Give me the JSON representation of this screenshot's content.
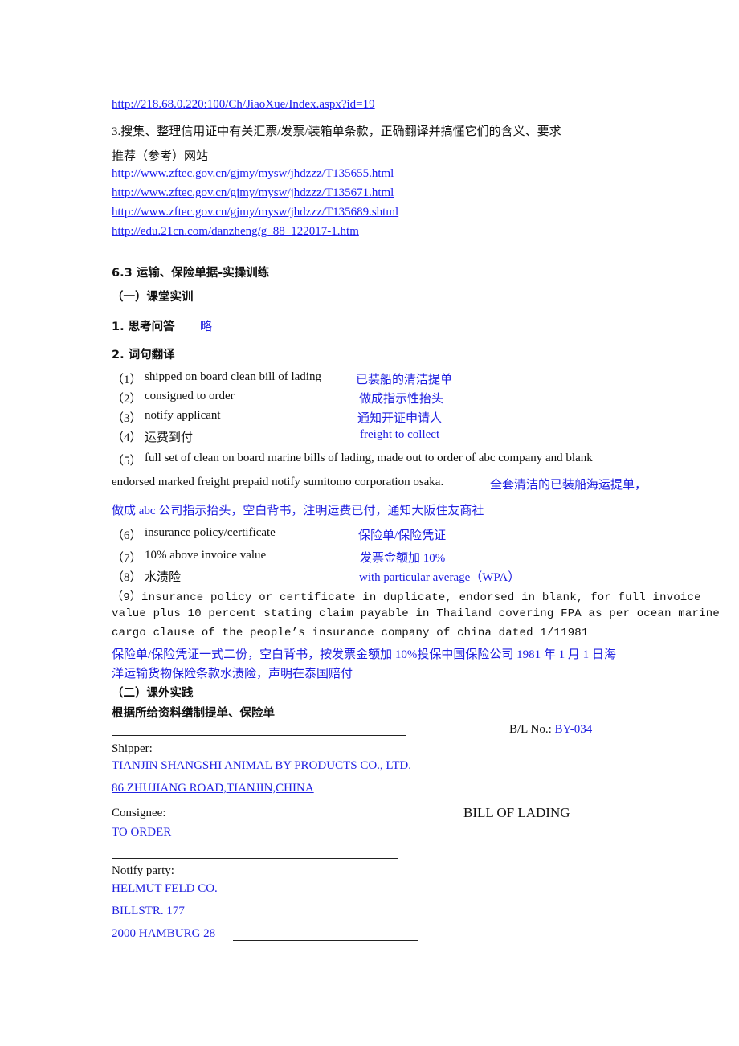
{
  "links_top": {
    "link0": "http://218.68.0.220:100/Ch/JiaoXue/Index.aspx?id=19",
    "item3": "3.搜集、整理信用证中有关汇票/发票/装箱单条款，正确翻译并搞懂它们的含义、要求",
    "recommend": "推荐（参考）网站",
    "links": [
      "http://www.zftec.gov.cn/gjmy/mysw/jhdzzz/T135655.html",
      "http://www.zftec.gov.cn/gjmy/mysw/jhdzzz/T135671.html",
      "http://www.zftec.gov.cn/gjmy/mysw/jhdzzz/T135689.shtml",
      "http://edu.21cn.com/danzheng/g_88_122017-1.htm"
    ]
  },
  "section": {
    "title": "6.3 运输、保险单据-实操训练",
    "part1": "（一）课堂实训",
    "q1_label": "1. 思考问答",
    "q1_answer": "略",
    "q2_label": "2. 词句翻译"
  },
  "translations": [
    {
      "num": "（1）",
      "src": "shipped on board clean bill of lading",
      "ans": "已装船的清洁提单"
    },
    {
      "num": "（2）",
      "src": "consigned to order",
      "ans": "做成指示性抬头"
    },
    {
      "num": "（3）",
      "src": "notify applicant",
      "ans": "通知开证申请人"
    },
    {
      "num": "（4）",
      "src": "运费到付",
      "ans": "freight to collect"
    }
  ],
  "item5": {
    "num": "（5）",
    "line1": "full set of clean on board marine bills of lading, made out to order of abc company and blank",
    "line2": "endorsed marked freight prepaid notify sumitomo corporation osaka.",
    "ans1": "全套清洁的已装船海运提单，",
    "ans2": "做成 abc 公司指示抬头，空白背书，注明运费已付，通知大阪住友商社"
  },
  "translations2": [
    {
      "num": "（6）",
      "src": "insurance policy/certificate",
      "ans": "保险单/保险凭证"
    },
    {
      "num": "（7）",
      "src": "10% above invoice value",
      "ans": "发票金额加 10%"
    },
    {
      "num": "（8）",
      "src": "水渍险",
      "ans": "with particular average（WPA）"
    }
  ],
  "item9": {
    "line1": "（9）insurance policy or certificate in  duplicate, endorsed in blank, for full invoice",
    "line2": "value plus 10 percent stating claim payable in Thailand covering FPA as per ocean marine",
    "line3": "cargo clause of the people’s insurance company of china dated 1/11981",
    "ans1": "保险单/保险凭证一式二份，空白背书，按发票金额加 10%投保中国保险公司 1981 年 1 月 1 日海",
    "ans2": "洋运输货物保险条款水渍险，声明在泰国赔付"
  },
  "part2": {
    "title": "（二）课外实践",
    "instruction": "根据所给资料缮制提单、保险单"
  },
  "bl": {
    "no_label": "B/L No.:",
    "no_value": "BY-034",
    "shipper_label": "Shipper:",
    "shipper_name": "TIANJIN SHANGSHI ANIMAL BY PRODUCTS CO., LTD.",
    "shipper_addr": "86 ZHUJIANG ROAD,TIANJIN,CHINA",
    "consignee_label": "Consignee:",
    "consignee_value": "TO ORDER",
    "doc_title": "BILL OF LADING",
    "notify_label": "Notify party:",
    "notify_name": "HELMUT FELD CO.",
    "notify_street": "BILLSTR. 177",
    "notify_city": "2000 HAMBURG 28"
  }
}
